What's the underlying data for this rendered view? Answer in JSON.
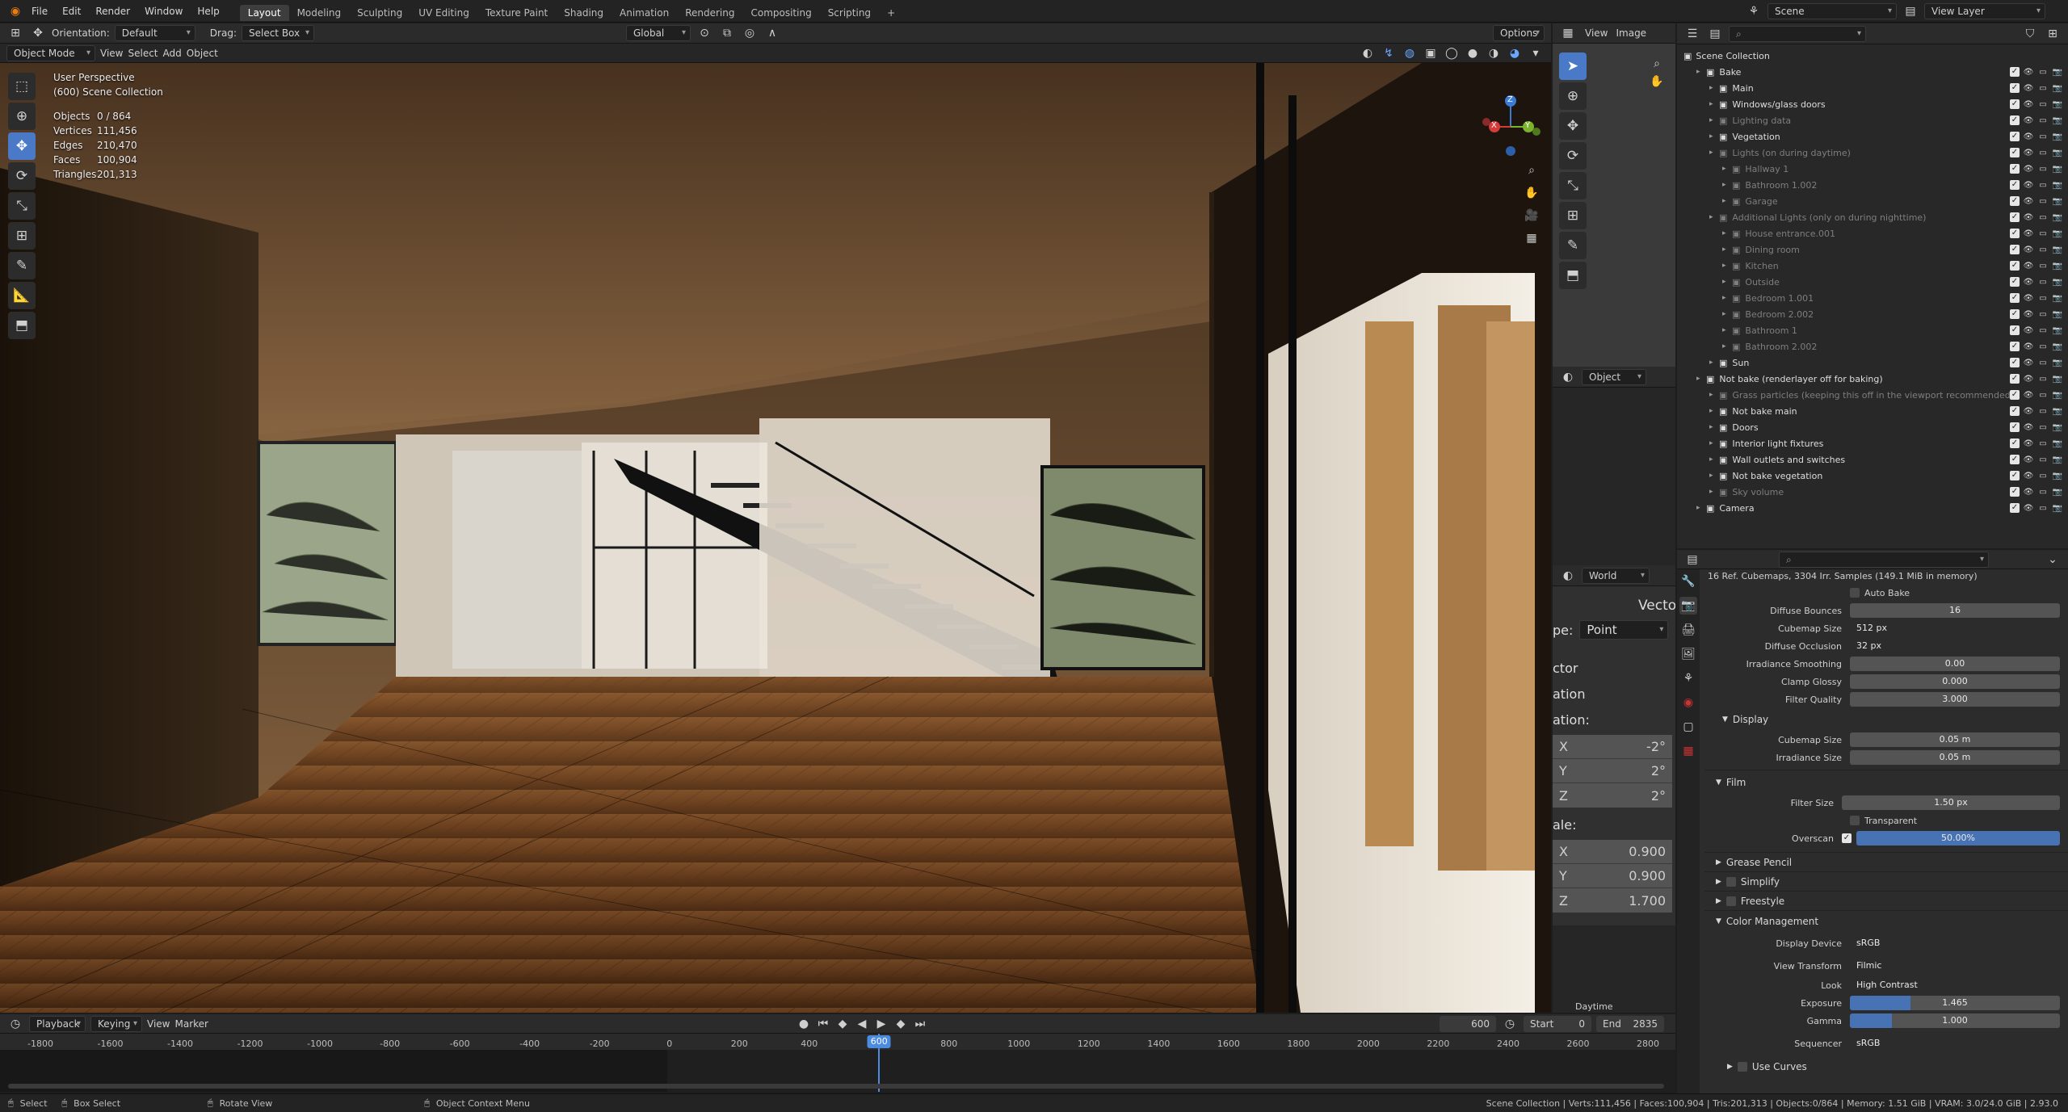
{
  "topbar": {
    "menus": [
      "File",
      "Edit",
      "Render",
      "Window",
      "Help"
    ],
    "workspaces": [
      "Layout",
      "Modeling",
      "Sculpting",
      "UV Editing",
      "Texture Paint",
      "Shading",
      "Animation",
      "Rendering",
      "Compositing",
      "Scripting"
    ],
    "active_workspace": "Layout",
    "scene": "Scene",
    "view_layer": "View Layer"
  },
  "viewport_header": {
    "orientation_label": "Orientation:",
    "orientation_value": "Default",
    "drag_label": "Drag:",
    "drag_value": "Select Box",
    "transform_space": "Global",
    "options": "Options",
    "mode": "Object Mode",
    "menus": [
      "View",
      "Select",
      "Add",
      "Object"
    ]
  },
  "viewport_overlay": {
    "perspective": "User Perspective",
    "collection": "(600) Scene Collection",
    "stats": [
      {
        "label": "Objects",
        "value": "0 / 864"
      },
      {
        "label": "Vertices",
        "value": "111,456"
      },
      {
        "label": "Edges",
        "value": "210,470"
      },
      {
        "label": "Faces",
        "value": "100,904"
      },
      {
        "label": "Triangles",
        "value": "201,313"
      }
    ],
    "gizmo": {
      "z": "Z",
      "x": "X",
      "y": "Y"
    }
  },
  "image_editor": {
    "menus": [
      "View",
      "Image"
    ],
    "object_dropdown": "Object",
    "world_dropdown": "World",
    "vector_title": "Vecto",
    "type_label": "pe:",
    "type_value": "Point",
    "section_vector": "ctor",
    "section_location": "ation",
    "section_rotation": "ation:",
    "rotation": [
      {
        "axis": "X",
        "value": "-2°"
      },
      {
        "axis": "Y",
        "value": "2°"
      },
      {
        "axis": "Z",
        "value": "2°"
      }
    ],
    "scale_label": "ale:",
    "scale": [
      {
        "axis": "X",
        "value": "0.900"
      },
      {
        "axis": "Y",
        "value": "0.900"
      },
      {
        "axis": "Z",
        "value": "1.700"
      }
    ],
    "footer": "Daytime"
  },
  "outliner": {
    "root": "Scene Collection",
    "rows": [
      {
        "name": "Bake",
        "depth": 1,
        "dim": false
      },
      {
        "name": "Main",
        "depth": 2,
        "dim": false
      },
      {
        "name": "Windows/glass doors",
        "depth": 2,
        "dim": false
      },
      {
        "name": "Lighting data",
        "depth": 2,
        "dim": true
      },
      {
        "name": "Vegetation",
        "depth": 2,
        "dim": false
      },
      {
        "name": "Lights (on during daytime)",
        "depth": 2,
        "dim": true
      },
      {
        "name": "Hallway 1",
        "depth": 3,
        "dim": true
      },
      {
        "name": "Bathroom 1.002",
        "depth": 3,
        "dim": true
      },
      {
        "name": "Garage",
        "depth": 3,
        "dim": true
      },
      {
        "name": "Additional Lights (only on during nighttime)",
        "depth": 2,
        "dim": true
      },
      {
        "name": "House entrance.001",
        "depth": 3,
        "dim": true
      },
      {
        "name": "Dining room",
        "depth": 3,
        "dim": true
      },
      {
        "name": "Kitchen",
        "depth": 3,
        "dim": true
      },
      {
        "name": "Outside",
        "depth": 3,
        "dim": true
      },
      {
        "name": "Bedroom 1.001",
        "depth": 3,
        "dim": true
      },
      {
        "name": "Bedroom 2.002",
        "depth": 3,
        "dim": true
      },
      {
        "name": "Bathroom 1",
        "depth": 3,
        "dim": true
      },
      {
        "name": "Bathroom 2.002",
        "depth": 3,
        "dim": true
      },
      {
        "name": "Sun",
        "depth": 2,
        "dim": false
      },
      {
        "name": "Not bake (renderlayer off for baking)",
        "depth": 1,
        "dim": false
      },
      {
        "name": "Grass particles (keeping this off in the viewport recommended)",
        "depth": 2,
        "dim": true
      },
      {
        "name": "Not bake main",
        "depth": 2,
        "dim": false
      },
      {
        "name": "Doors",
        "depth": 2,
        "dim": false
      },
      {
        "name": "Interior light fixtures",
        "depth": 2,
        "dim": false
      },
      {
        "name": "Wall outlets and switches",
        "depth": 2,
        "dim": false
      },
      {
        "name": "Not bake vegetation",
        "depth": 2,
        "dim": false
      },
      {
        "name": "Sky volume",
        "depth": 2,
        "dim": true
      },
      {
        "name": "Camera",
        "depth": 1,
        "dim": false
      }
    ]
  },
  "properties": {
    "info": "16 Ref. Cubemaps, 3304 Irr. Samples (149.1 MiB in memory)",
    "auto_bake": "Auto Bake",
    "fields": [
      {
        "label": "Diffuse Bounces",
        "value": "16"
      },
      {
        "label": "Cubemap Size",
        "value": "512 px"
      },
      {
        "label": "Diffuse Occlusion",
        "value": "32 px"
      },
      {
        "label": "Irradiance Smoothing",
        "value": "0.00"
      },
      {
        "label": "Clamp Glossy",
        "value": "0.000"
      },
      {
        "label": "Filter Quality",
        "value": "3.000"
      }
    ],
    "display_section": "Display",
    "display_fields": [
      {
        "label": "Cubemap Size",
        "value": "0.05 m"
      },
      {
        "label": "Irradiance Size",
        "value": "0.05 m"
      }
    ],
    "film_section": "Film",
    "filter_size_label": "Filter Size",
    "filter_size": "1.50 px",
    "transparent": "Transparent",
    "overscan_label": "Overscan",
    "overscan_value": "50.00%",
    "overscan_fraction": 0.5,
    "grease_pencil": "Grease Pencil",
    "simplify": "Simplify",
    "freestyle": "Freestyle",
    "color_management": "Color Management",
    "cm_fields": [
      {
        "label": "Display Device",
        "value": "sRGB"
      },
      {
        "label": "View Transform",
        "value": "Filmic"
      },
      {
        "label": "Look",
        "value": "High Contrast"
      }
    ],
    "exposure_label": "Exposure",
    "exposure_value": "1.465",
    "exposure_fraction": 0.29,
    "gamma_label": "Gamma",
    "gamma_value": "1.000",
    "gamma_fraction": 0.2,
    "sequencer_label": "Sequencer",
    "sequencer_value": "sRGB",
    "use_curves": "Use Curves"
  },
  "timeline": {
    "menus": [
      "Playback",
      "Keying",
      "View",
      "Marker"
    ],
    "current_frame": "600",
    "start_label": "Start",
    "start": "0",
    "end_label": "End",
    "end": "2835",
    "ticks": [
      "-1800",
      "-1600",
      "-1400",
      "-1200",
      "-1000",
      "-800",
      "-600",
      "-400",
      "-200",
      "0",
      "200",
      "400",
      "600",
      "800",
      "1000",
      "1200",
      "1400",
      "1600",
      "1800",
      "2000",
      "2200",
      "2400",
      "2600",
      "2800"
    ]
  },
  "statusbar": {
    "select": "Select",
    "box_select": "Box Select",
    "rotate_view": "Rotate View",
    "context_menu": "Object Context Menu",
    "stats": "Scene Collection | Verts:111,456 | Faces:100,904 | Tris:201,313 | Objects:0/864 | Memory: 1.51 GiB | VRAM: 3.0/24.0 GiB | 2.93.0"
  }
}
